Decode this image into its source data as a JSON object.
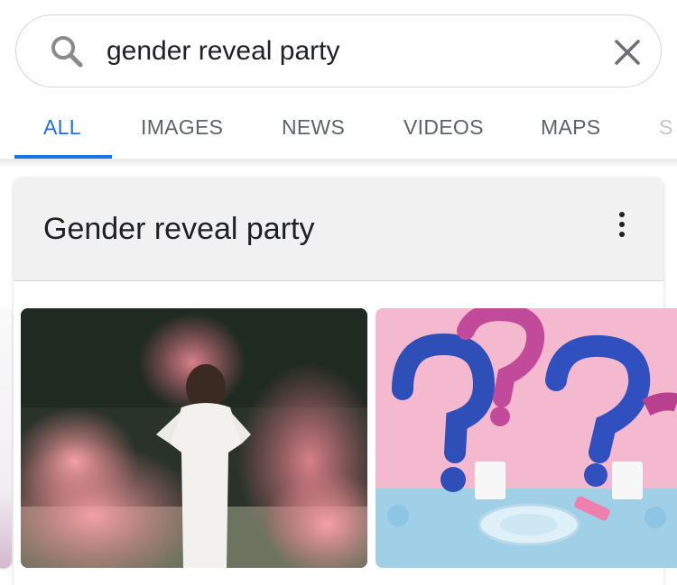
{
  "search": {
    "query": "gender reveal party"
  },
  "tabs": [
    {
      "label": "ALL",
      "active": true
    },
    {
      "label": "IMAGES",
      "active": false
    },
    {
      "label": "NEWS",
      "active": false
    },
    {
      "label": "VIDEOS",
      "active": false
    },
    {
      "label": "MAPS",
      "active": false
    },
    {
      "label": "S",
      "active": false
    }
  ],
  "card": {
    "title": "Gender reveal party"
  },
  "icons": {
    "search": "search-icon",
    "clear": "close-icon",
    "more": "more-vert-icon"
  },
  "colors": {
    "accent": "#1a73e8",
    "tab_inactive": "#5f6368",
    "text": "#202124"
  }
}
